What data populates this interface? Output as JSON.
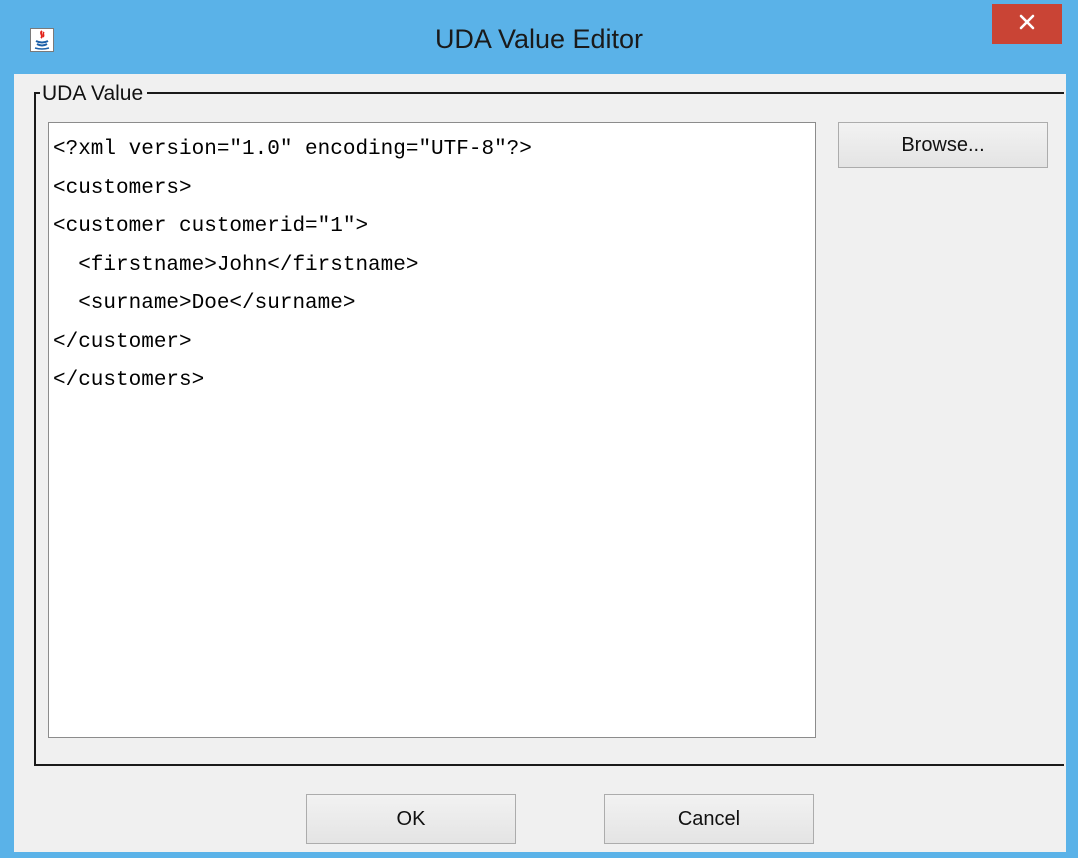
{
  "window": {
    "title": "UDA Value Editor",
    "app_icon": "java-icon",
    "close_icon": "close-icon",
    "frame_color": "#5ab2e8",
    "close_color": "#c94435"
  },
  "group": {
    "label": "UDA Value"
  },
  "editor": {
    "lines": [
      "<?xml version=\"1.0\" encoding=\"UTF-8\"?>",
      "<customers>",
      "<customer customerid=\"1\">",
      "  <firstname>John</firstname>",
      "  <surname>Doe</surname>",
      "</customer>",
      "</customers>"
    ]
  },
  "buttons": {
    "browse": "Browse...",
    "ok": "OK",
    "cancel": "Cancel"
  }
}
